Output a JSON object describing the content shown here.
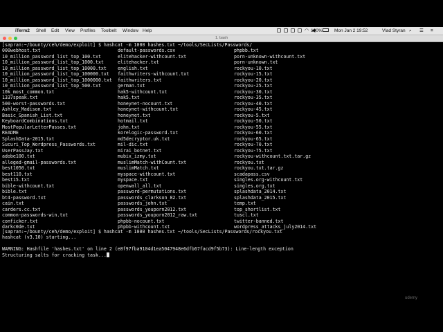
{
  "menubar": {
    "app": "iTerm2",
    "items": [
      "Shell",
      "Edit",
      "View",
      "Profiles",
      "Toolbelt",
      "Window",
      "Help"
    ],
    "battery": "100%",
    "clock": "Mon Jan 2  19:52",
    "user": "Vlad Styran"
  },
  "window": {
    "title": "1. bash"
  },
  "terminal": {
    "prompt1": "[sapran:~/bounty/ceh/demo/exploit] $ hashcat -m 1000 hashes.txt ~/tools/SecLists/Passwords/",
    "col1": [
      "000webhost.txt",
      "10_million_password_list_top_100.txt",
      "10_million_password_list_top_1000.txt",
      "10_million_password_list_top_10000.txt",
      "10_million_password_list_top_100000.txt",
      "10_million_password_list_top_1000000.txt",
      "10_million_password_list_top_500.txt",
      "10k_most_common.txt",
      "1337speak.txt",
      "500-worst-passwords.txt",
      "Ashley_Madison.txt",
      "Basic_Spanish_List.txt",
      "KeyboardCombinations.txt",
      "MostPopularLetterPasses.txt",
      "README",
      "SplashData-2015.txt",
      "Sucuri_Top_Wordpress_Passwords.txt",
      "UserPassJay.txt",
      "adobe100.txt",
      "alleged-gmail-passwords.txt",
      "best1050.txt",
      "best110.txt",
      "best15.txt",
      "bible-withcount.txt",
      "bible.txt",
      "bt4-password.txt",
      "cain.txt",
      "carders.cc.txt",
      "common-passwords-win.txt",
      "conficker.txt",
      "darkc0de.txt"
    ],
    "col2": [
      "default-passwords.csv",
      "elitehacker-withcount.txt",
      "elitehacker.txt",
      "english.txt",
      "faithwriters-withcount.txt",
      "faithwriters.txt",
      "german.txt",
      "hak5-withcount.txt",
      "hak5.txt",
      "honeynet-nocount.txt",
      "honeynet-withcount.txt",
      "honeynet.txt",
      "hotmail.txt",
      "john.txt",
      "korelogic-password.txt",
      "md5decryptor.uk.txt",
      "mil-dic.txt",
      "mirai_botnet.txt",
      "mubix_izmy.txt",
      "muslimMatch-withCount.txt",
      "muslimMatch.txt",
      "myspace-withcount.txt",
      "myspace.txt",
      "openwall_all.txt",
      "password-permutations.txt",
      "passwords_clarkson_82.txt",
      "passwords_john.txt",
      "passwords_youporn2012.txt",
      "passwords_youporn2012_raw.txt",
      "phpbb-nocount.txt",
      "phpbb-withcount.txt"
    ],
    "col3": [
      "phpbb.txt",
      "porn-unknown-withcount.txt",
      "porn-unknown.txt",
      "rockyou-10.txt",
      "rockyou-15.txt",
      "rockyou-20.txt",
      "rockyou-25.txt",
      "rockyou-30.txt",
      "rockyou-35.txt",
      "rockyou-40.txt",
      "rockyou-45.txt",
      "rockyou-5.txt",
      "rockyou-50.txt",
      "rockyou-55.txt",
      "rockyou-60.txt",
      "rockyou-65.txt",
      "rockyou-70.txt",
      "rockyou-75.txt",
      "rockyou-withcount.txt.tar.gz",
      "rockyou.txt",
      "rockyou.txt.tar.gz",
      "scadapass.csv",
      "singles.org-withcount.txt",
      "singles.org.txt",
      "splashdata_2014.txt",
      "splashdata_2015.txt",
      "temp.txt",
      "top_shortlist.txt",
      "tuscl.txt",
      "twitter-banned.txt",
      "wordpress_attacks_july2014.txt"
    ],
    "prompt2": "[sapran:~/bounty/ceh/demo/exploit] $ hashcat -m 1000 hashes.txt ~/tools/SecLists/Passwords/rockyou.txt",
    "starting": "hashcat (v3.10) starting...",
    "warning": "WARNING: Hashfile 'hashes.txt' on line 2 (e8f97fba9104d1ea5047948e6dfb67facd9f5b73): Line-length exception",
    "structuring": "Structuring salts for cracking task..."
  },
  "watermark": "udemy"
}
